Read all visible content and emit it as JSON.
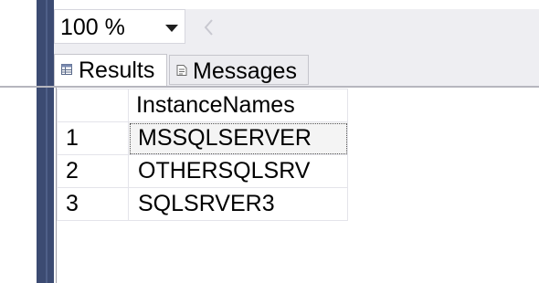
{
  "toolbar": {
    "zoom_value": "100 %"
  },
  "tabs": {
    "results_label": "Results",
    "messages_label": "Messages",
    "results_icon": "grid-icon",
    "messages_icon": "messages-icon"
  },
  "grid": {
    "columns": [
      "",
      "InstanceNames"
    ],
    "rows": [
      {
        "num": "1",
        "name": "MSSQLSERVER"
      },
      {
        "num": "2",
        "name": "OTHERSQLSRV"
      },
      {
        "num": "3",
        "name": "SQLSRVER3"
      }
    ]
  },
  "colors": {
    "editor_margin": "#3c4b72",
    "toolbar_bg": "#eeeef2"
  }
}
